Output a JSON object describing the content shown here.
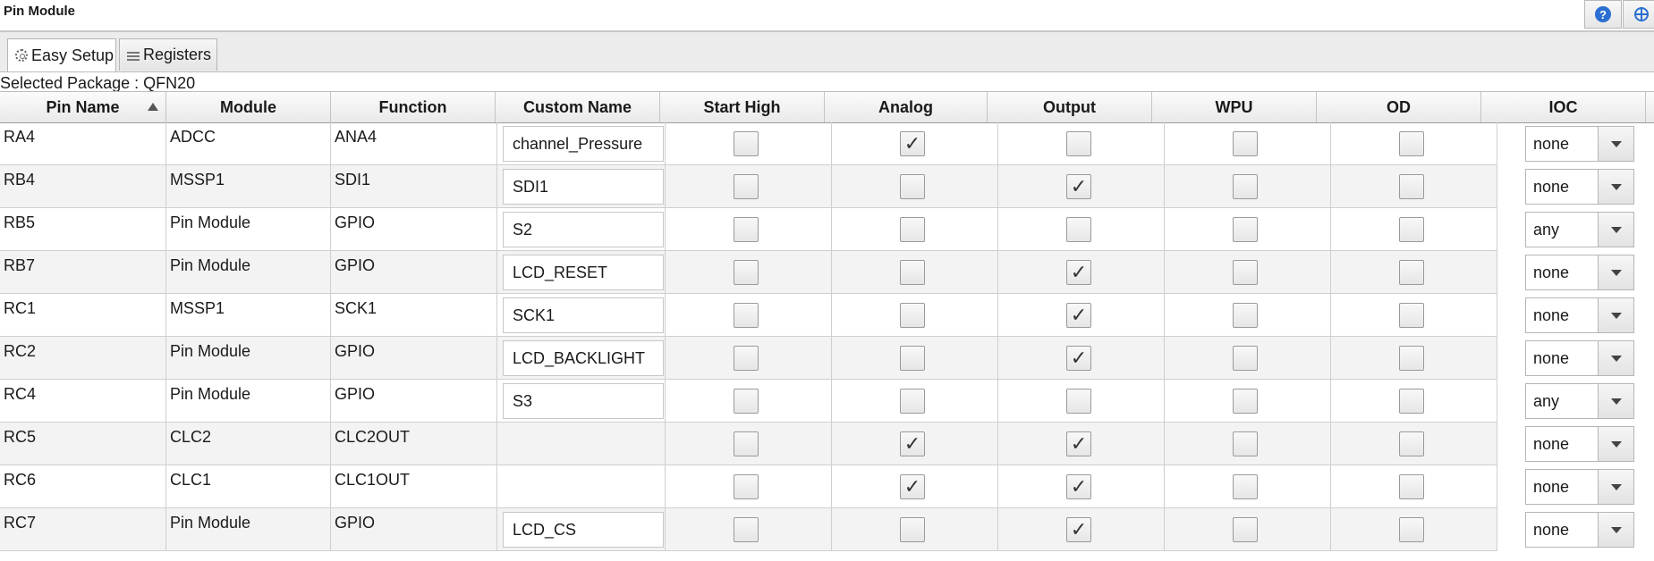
{
  "window": {
    "title": "Pin Module"
  },
  "tabs": [
    {
      "label": "Easy Setup",
      "icon": "gear-icon"
    },
    {
      "label": "Registers",
      "icon": "list-icon"
    }
  ],
  "package_label": "Selected Package : QFN20",
  "columns": [
    "Pin Name",
    "Module",
    "Function",
    "Custom Name",
    "Start High",
    "Analog",
    "Output",
    "WPU",
    "OD",
    "IOC"
  ],
  "sort": {
    "column": "Pin Name",
    "direction": "ascending"
  },
  "rows": [
    {
      "pin": "RA4",
      "module": "ADCC",
      "function": "ANA4",
      "custom_name": "channel_Pressure",
      "start_high": false,
      "analog": true,
      "output": false,
      "wpu": false,
      "od": false,
      "ioc": "none"
    },
    {
      "pin": "RB4",
      "module": "MSSP1",
      "function": "SDI1",
      "custom_name": "SDI1",
      "start_high": false,
      "analog": false,
      "output": true,
      "wpu": false,
      "od": false,
      "ioc": "none"
    },
    {
      "pin": "RB5",
      "module": "Pin Module",
      "function": "GPIO",
      "custom_name": "S2",
      "start_high": false,
      "analog": false,
      "output": false,
      "wpu": false,
      "od": false,
      "ioc": "any"
    },
    {
      "pin": "RB7",
      "module": "Pin Module",
      "function": "GPIO",
      "custom_name": "LCD_RESET",
      "start_high": false,
      "analog": false,
      "output": true,
      "wpu": false,
      "od": false,
      "ioc": "none"
    },
    {
      "pin": "RC1",
      "module": "MSSP1",
      "function": "SCK1",
      "custom_name": "SCK1",
      "start_high": false,
      "analog": false,
      "output": true,
      "wpu": false,
      "od": false,
      "ioc": "none"
    },
    {
      "pin": "RC2",
      "module": "Pin Module",
      "function": "GPIO",
      "custom_name": "LCD_BACKLIGHT",
      "start_high": false,
      "analog": false,
      "output": true,
      "wpu": false,
      "od": false,
      "ioc": "none"
    },
    {
      "pin": "RC4",
      "module": "Pin Module",
      "function": "GPIO",
      "custom_name": "S3",
      "start_high": false,
      "analog": false,
      "output": false,
      "wpu": false,
      "od": false,
      "ioc": "any"
    },
    {
      "pin": "RC5",
      "module": "CLC2",
      "function": "CLC2OUT",
      "custom_name": null,
      "start_high": false,
      "analog": true,
      "output": true,
      "wpu": false,
      "od": false,
      "ioc": "none"
    },
    {
      "pin": "RC6",
      "module": "CLC1",
      "function": "CLC1OUT",
      "custom_name": null,
      "start_high": false,
      "analog": true,
      "output": true,
      "wpu": false,
      "od": false,
      "ioc": "none"
    },
    {
      "pin": "RC7",
      "module": "Pin Module",
      "function": "GPIO",
      "custom_name": "LCD_CS",
      "start_high": false,
      "analog": false,
      "output": true,
      "wpu": false,
      "od": false,
      "ioc": "none"
    }
  ],
  "check_glyph": "✓",
  "icons": {
    "help": "help-icon",
    "globe": "globe-icon",
    "dropdown": "chevron-down-icon"
  },
  "colors": {
    "help_blue": "#2a6fd1",
    "row_alt": "#f3f3f3"
  }
}
